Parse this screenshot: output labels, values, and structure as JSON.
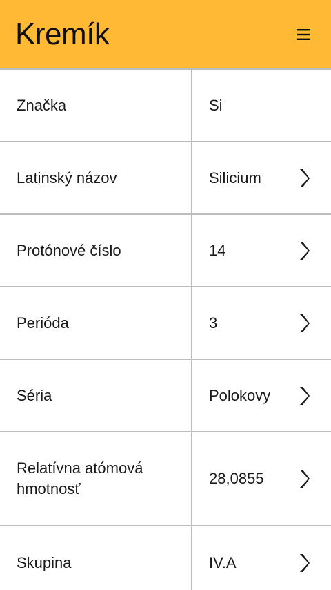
{
  "header": {
    "title": "Kremík",
    "menu_icon": "hamburger-menu-icon",
    "background_color": "#FFB935"
  },
  "rows": [
    {
      "label": "Značka",
      "value": "Si",
      "has_chevron": false
    },
    {
      "label": "Latinský názov",
      "value": "Silicium",
      "has_chevron": true
    },
    {
      "label": "Protónové číslo",
      "value": "14",
      "has_chevron": true
    },
    {
      "label": "Perióda",
      "value": "3",
      "has_chevron": true
    },
    {
      "label": "Séria",
      "value": "Polokovy",
      "has_chevron": true
    },
    {
      "label": "Relatívna atómová hmotnosť",
      "value": "28,0855",
      "has_chevron": true
    },
    {
      "label": "Skupina",
      "value": "IV.A",
      "has_chevron": true
    }
  ]
}
